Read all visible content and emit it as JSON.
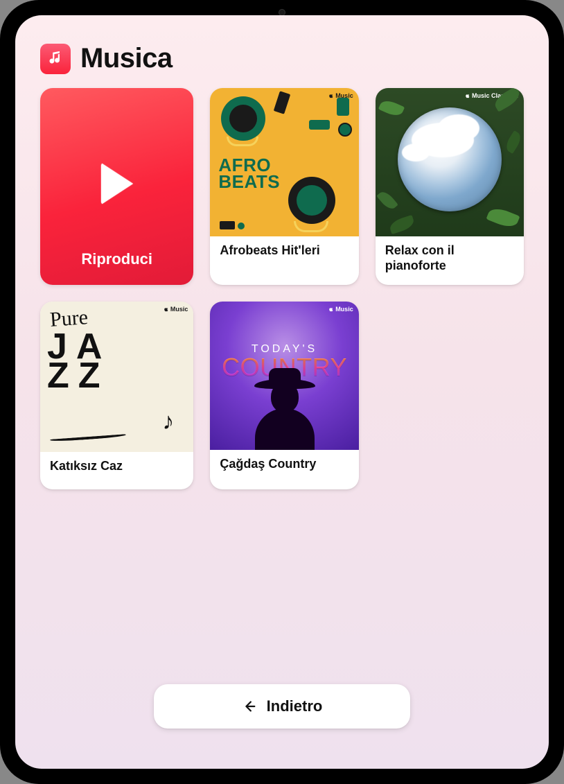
{
  "app": {
    "title": "Musica",
    "icon": "music-note-icon"
  },
  "colors": {
    "accent": "#fa233b",
    "play_gradient_start": "#ff5a5f",
    "play_gradient_end": "#e21b38"
  },
  "play_tile": {
    "label": "Riproduci"
  },
  "playlists": [
    {
      "id": "afrobeats",
      "title": "Afrobeats Hit'leri",
      "brand": "Music",
      "art_text_line1": "AFRO",
      "art_text_line2": "BEATS"
    },
    {
      "id": "relax-piano",
      "title": "Relax con il pianoforte",
      "brand": "Music Classical"
    },
    {
      "id": "pure-jazz",
      "title": "Katıksız Caz",
      "brand": "Music",
      "art_text_pure": "Pure",
      "art_text_j": "J",
      "art_text_a1": "A",
      "art_text_z1": "Z",
      "art_text_z2": "Z"
    },
    {
      "id": "todays-country",
      "title": "Çağdaş Country",
      "brand": "Music",
      "art_text_top": "TODAY'S",
      "art_text_main": "COUNTRY"
    }
  ],
  "back_button": {
    "label": "Indietro"
  }
}
